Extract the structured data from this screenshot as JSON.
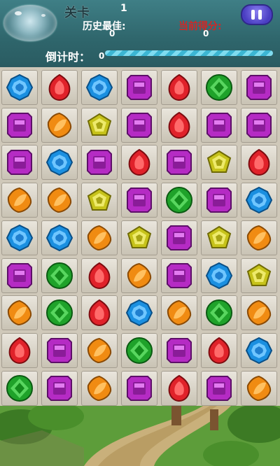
{
  "header": {
    "level_label": "关卡",
    "level_value": "1",
    "best_label": "历史最佳:",
    "best_value": "0",
    "score_label": "当前得分:",
    "score_value": "0",
    "timer_label": "倒计时：",
    "timer_value": "0",
    "timer_progress": 1.0
  },
  "colors": {
    "blue": "#1a8fe0",
    "red": "#e0222a",
    "purple": "#b52bc4",
    "green": "#1fa22a",
    "orange": "#f08b12",
    "yellow": "#c6c21a"
  },
  "board": {
    "rows": [
      [
        "blue",
        "red",
        "blue",
        "purple",
        "red",
        "green",
        "purple"
      ],
      [
        "purple",
        "orange",
        "yellow",
        "purple",
        "red",
        "purple",
        "purple"
      ],
      [
        "purple",
        "blue",
        "purple",
        "red",
        "purple",
        "yellow",
        "red"
      ],
      [
        "orange",
        "orange",
        "yellow",
        "purple",
        "green",
        "purple",
        "blue"
      ],
      [
        "blue",
        "blue",
        "orange",
        "yellow",
        "purple",
        "yellow",
        "orange"
      ],
      [
        "purple",
        "green",
        "red",
        "orange",
        "purple",
        "blue",
        "yellow"
      ],
      [
        "orange",
        "green",
        "red",
        "blue",
        "orange",
        "green",
        "orange"
      ],
      [
        "red",
        "purple",
        "orange",
        "green",
        "purple",
        "red",
        "blue"
      ],
      [
        "green",
        "purple",
        "orange",
        "purple",
        "red",
        "purple",
        "orange"
      ]
    ]
  }
}
